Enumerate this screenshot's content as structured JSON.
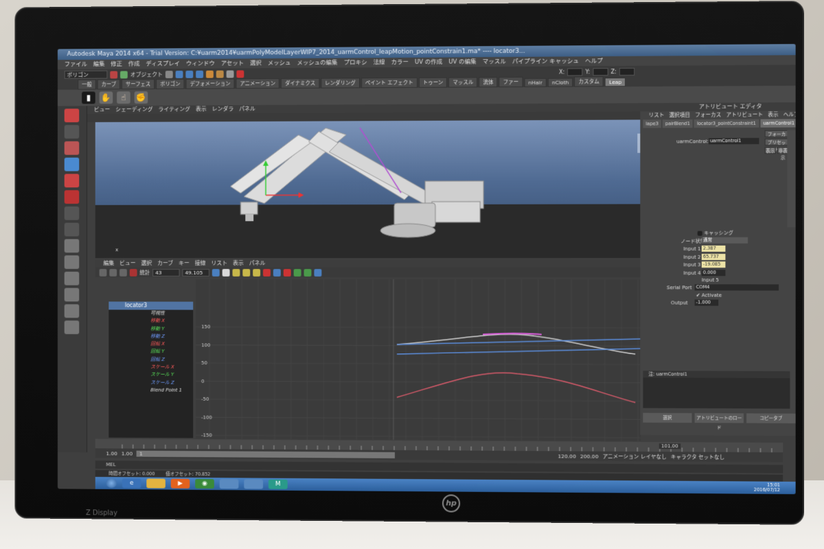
{
  "window": {
    "title": "Autodesk Maya 2014 x64 - Trial Version: C:¥uarm2014¥uarmPolyModelLayerWIP7_2014_uarmControl_leapMotion_pointConstrain1.ma* ---- locator3..."
  },
  "menubar": [
    "ファイル",
    "編集",
    "修正",
    "作成",
    "ディスプレイ",
    "ウィンドウ",
    "アセット",
    "選択",
    "メッシュ",
    "メッシュの編集",
    "プロキシ",
    "法線",
    "カラー",
    "UV の作成",
    "UV の編集",
    "マッスル",
    "パイプライン キャッシュ",
    "ヘルプ"
  ],
  "statusline": {
    "mode": "ポリゴン",
    "objects_label": "オブジェクト",
    "x": "X:",
    "y": "Y:",
    "z": "Z:"
  },
  "shelf_tabs": [
    "一般",
    "カーブ",
    "サーフェス",
    "ポリゴン",
    "デフォメーション",
    "アニメーション",
    "ダイナミクス",
    "レンダリング",
    "ペイント エフェクト",
    "トゥーン",
    "マッスル",
    "流体",
    "ファー",
    "nHair",
    "nCloth",
    "カスタム",
    "Leap"
  ],
  "shelf_active": "Leap",
  "viewport": {
    "menu": [
      "ビュー",
      "シェーディング",
      "ライティング",
      "表示",
      "レンダラ",
      "パネル"
    ],
    "camera_label": "前"
  },
  "graph_editor": {
    "menu": [
      "編集",
      "ビュー",
      "選択",
      "カーブ",
      "キー",
      "接線",
      "リスト",
      "表示",
      "パネル"
    ],
    "stats_label": "統計",
    "frame_value": "43",
    "value_field": "49.105",
    "outliner_header": "locator3",
    "channels": [
      {
        "label": "可視性",
        "color": "#e0e0e0"
      },
      {
        "label": "移動 X",
        "color": "#ff5a5a"
      },
      {
        "label": "移動 Y",
        "color": "#59e059"
      },
      {
        "label": "移動 Z",
        "color": "#6f9cff"
      },
      {
        "label": "回転 X",
        "color": "#ff5a5a"
      },
      {
        "label": "回転 Y",
        "color": "#59e059"
      },
      {
        "label": "回転 Z",
        "color": "#6f9cff"
      },
      {
        "label": "スケール X",
        "color": "#ff5a5a"
      },
      {
        "label": "スケール Y",
        "color": "#59e059"
      },
      {
        "label": "スケール Z",
        "color": "#6f9cff"
      },
      {
        "label": "Blend Point 1",
        "color": "#e0e0e0"
      }
    ],
    "y_ticks": [
      "150",
      "100",
      "50",
      "0",
      "-50",
      "-100",
      "-150"
    ]
  },
  "timeline": {
    "start": "1.00",
    "current": "1.00",
    "playback_start": "1",
    "range_end": "120.00",
    "anim_end": "200.00",
    "anim_layer": "アニメーション レイヤなし",
    "char_set": "キャラクタ セットなし",
    "current_frame": "101.00"
  },
  "mel": {
    "label": "MEL",
    "info_time_offset_label": "時間オフセット:",
    "info_time_offset": "0.000",
    "info_value_offset_label": "値オフセット:",
    "info_value_offset": "70.852"
  },
  "attribute_editor": {
    "title": "アトリビュート エディタ",
    "menu": [
      "リスト",
      "選択項目",
      "フォーカス",
      "アトリビュート",
      "表示",
      "ヘルプ"
    ],
    "tabs": [
      "lape3",
      "pairBlend1",
      "locator3_pointConstraint1",
      "uarmControl1"
    ],
    "active_tab": "uarmControl1",
    "node_label": "uarmControl:",
    "node_name": "uarmControl1",
    "focus_button": "フォーカス",
    "preset_button": "プリセット",
    "show_button": "表示",
    "hide_button": "非表示",
    "caching_label": "キャッシング",
    "node_state_label": "ノード状態",
    "node_state_value": "通常",
    "inputs": [
      {
        "label": "Input 1",
        "value": "2.387"
      },
      {
        "label": "Input 2",
        "value": "65.737"
      },
      {
        "label": "Input 3",
        "value": "-19.085"
      },
      {
        "label": "Input 4",
        "value": "0.000"
      }
    ],
    "input5_label": "Input 5",
    "serial_port_label": "Serial Port",
    "serial_port_value": "COM4",
    "activate_label": "Activate",
    "output_label": "Output",
    "output_value": "-1.000",
    "notes_label": "注: uarmControl1",
    "bottom_buttons": [
      "選択",
      "アトリビュートのロード",
      "コピータブ"
    ]
  },
  "taskbar": {
    "clock_time": "15:01",
    "clock_date": "2016/07/12"
  },
  "bezel": {
    "logo": "hp",
    "brand": "Z Display"
  }
}
